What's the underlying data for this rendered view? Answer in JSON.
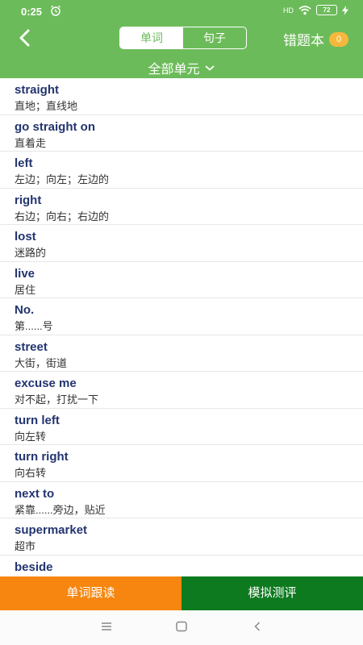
{
  "status": {
    "time": "0:25",
    "signal": "HD",
    "battery": "72"
  },
  "header": {
    "tabs": [
      {
        "label": "单词",
        "active": true
      },
      {
        "label": "句子",
        "active": false
      }
    ],
    "error_book_label": "错题本",
    "error_count": "0",
    "unit_selector": "全部单元"
  },
  "words": [
    {
      "word": "straight",
      "meaning": "直地；直线地"
    },
    {
      "word": "go straight on",
      "meaning": "直着走"
    },
    {
      "word": "left",
      "meaning": "左边；向左；左边的"
    },
    {
      "word": "right",
      "meaning": "右边；向右；右边的"
    },
    {
      "word": "lost",
      "meaning": "迷路的"
    },
    {
      "word": "live",
      "meaning": "居住"
    },
    {
      "word": "No.",
      "meaning": "第......号"
    },
    {
      "word": "street",
      "meaning": "大街，街道"
    },
    {
      "word": "excuse me",
      "meaning": "对不起，打扰一下"
    },
    {
      "word": "turn left",
      "meaning": "向左转"
    },
    {
      "word": "turn right",
      "meaning": "向右转"
    },
    {
      "word": "next to",
      "meaning": "紧靠......旁边，贴近"
    },
    {
      "word": "supermarket",
      "meaning": "超市"
    },
    {
      "word": "beside",
      "meaning": ""
    }
  ],
  "bottom": {
    "follow_read": "单词跟读",
    "mock_test": "模拟测评"
  },
  "colors": {
    "primary": "#6cbb5a",
    "orange": "#f6860f",
    "dark_green": "#0e7a1f",
    "word_text": "#23346f",
    "badge": "#f5b83c"
  }
}
